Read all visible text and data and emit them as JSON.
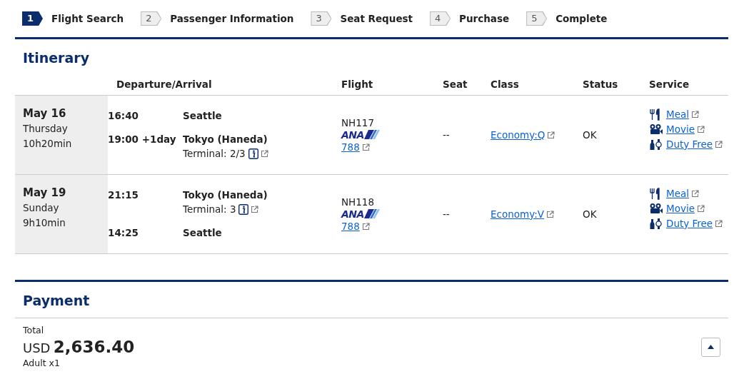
{
  "steps": [
    {
      "number": "1",
      "label": "Flight Search",
      "selected": true
    },
    {
      "number": "2",
      "label": "Passenger Information",
      "selected": false
    },
    {
      "number": "3",
      "label": "Seat Request",
      "selected": false
    },
    {
      "number": "4",
      "label": "Purchase",
      "selected": false
    },
    {
      "number": "5",
      "label": "Complete",
      "selected": false
    }
  ],
  "itinerary": {
    "title": "Itinerary",
    "columns": [
      "Departure/Arrival",
      "Flight",
      "Seat",
      "Class",
      "Status",
      "Service"
    ],
    "rows": [
      {
        "date": "May 16",
        "weekday": "Thursday",
        "duration": "10h20min",
        "legs": [
          {
            "time": "16:40",
            "city": "Seattle"
          },
          {
            "time": "19:00 +1day",
            "city": "Tokyo (Haneda)",
            "terminal": "Terminal: 2/3"
          }
        ],
        "flight": "NH117",
        "airline": "ANA",
        "aircraft": "788",
        "seat": "--",
        "class": "Economy:Q",
        "status": "OK",
        "services": [
          {
            "kind": "meal",
            "label": "Meal"
          },
          {
            "kind": "movie",
            "label": "Movie"
          },
          {
            "kind": "dutyfree",
            "label": "Duty Free"
          }
        ]
      },
      {
        "date": "May 19",
        "weekday": "Sunday",
        "duration": "9h10min",
        "legs": [
          {
            "time": "21:15",
            "city": "Tokyo (Haneda)",
            "terminal": "Terminal: 3"
          },
          {
            "time": "14:25",
            "city": "Seattle"
          }
        ],
        "flight": "NH118",
        "airline": "ANA",
        "aircraft": "788",
        "seat": "--",
        "class": "Economy:V",
        "status": "OK",
        "services": [
          {
            "kind": "meal",
            "label": "Meal"
          },
          {
            "kind": "movie",
            "label": "Movie"
          },
          {
            "kind": "dutyfree",
            "label": "Duty Free"
          }
        ]
      }
    ]
  },
  "payment": {
    "title": "Payment",
    "total_label": "Total",
    "currency": "USD",
    "amount": "2,636.40",
    "passengers": "Adult x1"
  }
}
